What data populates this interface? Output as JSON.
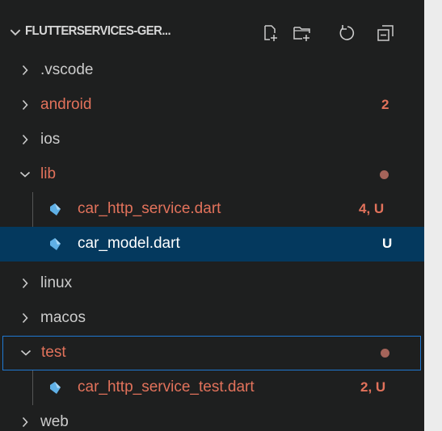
{
  "explorer": {
    "title": "FLUTTERSERVICES-GER...",
    "actions": [
      {
        "name": "new-file-icon"
      },
      {
        "name": "new-folder-icon"
      },
      {
        "name": "refresh-icon"
      },
      {
        "name": "collapse-all-icon"
      }
    ]
  },
  "tree": {
    "vscode": {
      "label": ".vscode"
    },
    "android": {
      "label": "android",
      "badge": "2"
    },
    "ios": {
      "label": "ios"
    },
    "lib": {
      "label": "lib"
    },
    "car_http_service": {
      "label": "car_http_service.dart",
      "badge": "4, U"
    },
    "car_model": {
      "label": "car_model.dart",
      "badge": "U"
    },
    "linux": {
      "label": "linux"
    },
    "macos": {
      "label": "macos"
    },
    "test": {
      "label": "test"
    },
    "car_http_service_test": {
      "label": "car_http_service_test.dart",
      "badge": "2, U"
    },
    "web": {
      "label": "web"
    }
  },
  "colors": {
    "modified": "#e2725b",
    "selected_bg": "#04395e",
    "focus_border": "#1f78d1",
    "dart_icon": "#5fb0e6"
  }
}
